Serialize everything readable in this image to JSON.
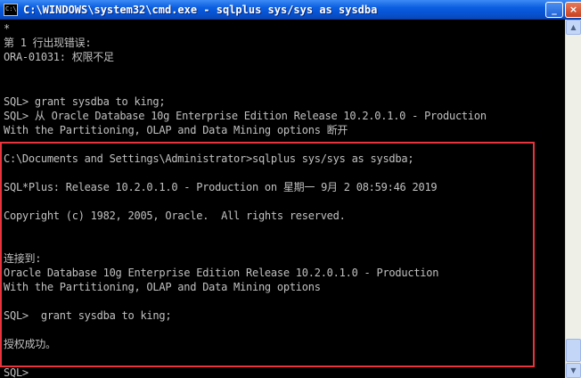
{
  "window": {
    "title": "C:\\WINDOWS\\system32\\cmd.exe - sqlplus sys/sys as sysdba",
    "icon_text": "C:\\",
    "minimize_glyph": "_",
    "close_glyph": "×"
  },
  "console": {
    "lines": [
      "*",
      "第 1 行出现错误:",
      "ORA-01031: 权限不足",
      "",
      "",
      "SQL> grant sysdba to king;",
      "SQL> 从 Oracle Database 10g Enterprise Edition Release 10.2.0.1.0 - Production",
      "With the Partitioning, OLAP and Data Mining options 断开",
      "",
      "C:\\Documents and Settings\\Administrator>sqlplus sys/sys as sysdba;",
      "",
      "SQL*Plus: Release 10.2.0.1.0 - Production on 星期一 9月 2 08:59:46 2019",
      "",
      "Copyright (c) 1982, 2005, Oracle.  All rights reserved.",
      "",
      "",
      "连接到:",
      "Oracle Database 10g Enterprise Edition Release 10.2.0.1.0 - Production",
      "With the Partitioning, OLAP and Data Mining options",
      "",
      "SQL>  grant sysdba to king;",
      "",
      "授权成功。",
      "",
      "SQL> "
    ]
  },
  "scrollbar": {
    "up_glyph": "▲",
    "down_glyph": "▼"
  },
  "colors": {
    "console_background": "#000000",
    "console_text": "#c0c0c0",
    "highlight_border": "#e8343c",
    "titlebar": "#0a5fe0"
  }
}
